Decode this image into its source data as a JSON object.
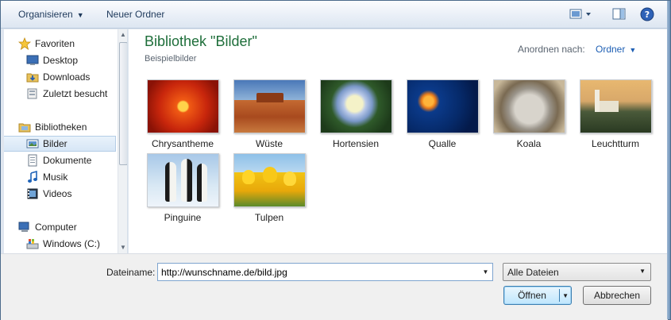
{
  "toolbar": {
    "organize_label": "Organisieren",
    "new_folder_label": "Neuer Ordner"
  },
  "nav": {
    "favorites": {
      "header": "Favoriten",
      "items": [
        "Desktop",
        "Downloads",
        "Zuletzt besucht"
      ]
    },
    "libraries": {
      "header": "Bibliotheken",
      "items": [
        "Bilder",
        "Dokumente",
        "Musik",
        "Videos"
      ],
      "selected": "Bilder"
    },
    "computer": {
      "header": "Computer",
      "items": [
        "Windows (C:)"
      ]
    }
  },
  "content": {
    "title": "Bibliothek \"Bilder\"",
    "subtitle": "Beispielbilder",
    "arrange_label": "Anordnen nach:",
    "arrange_value": "Ordner",
    "thumbnails": [
      "Chrysantheme",
      "Wüste",
      "Hortensien",
      "Qualle",
      "Koala",
      "Leuchtturm",
      "Pinguine",
      "Tulpen"
    ]
  },
  "footer": {
    "filename_label": "Dateiname:",
    "filename_value": "http://wunschname.de/bild.jpg",
    "filetype_value": "Alle Dateien",
    "open_label": "Öffnen",
    "cancel_label": "Abbrechen"
  },
  "colors": {
    "title_green": "#1e6e3a",
    "link_blue": "#1e5fb4",
    "selection": "#d7e6f6"
  }
}
